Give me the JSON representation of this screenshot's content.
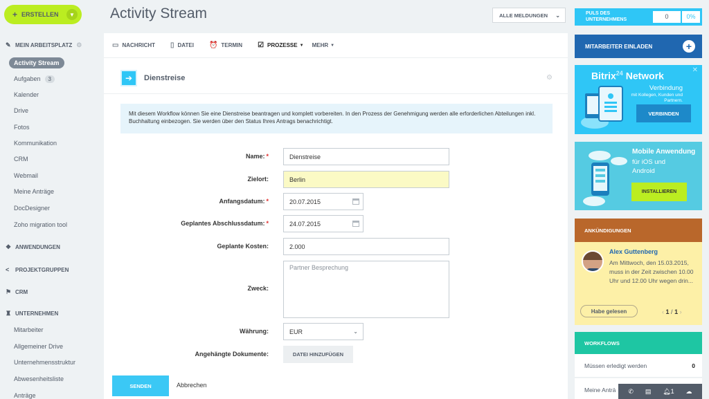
{
  "sidebar": {
    "create_label": "ERSTELLEN",
    "workplace_label": "MEIN ARBEITSPLATZ",
    "items": [
      {
        "label": "Activity Stream"
      },
      {
        "label": "Aufgaben",
        "badge": "3"
      },
      {
        "label": "Kalender"
      },
      {
        "label": "Drive"
      },
      {
        "label": "Fotos"
      },
      {
        "label": "Kommunikation"
      },
      {
        "label": "CRM"
      },
      {
        "label": "Webmail"
      },
      {
        "label": "Meine Anträge"
      },
      {
        "label": "DocDesigner"
      },
      {
        "label": "Zoho migration tool"
      }
    ],
    "sections": {
      "apps": "ANWENDUNGEN",
      "groups": "PROJEKTGRUPPEN",
      "crm": "CRM",
      "company": "UNTERNEHMEN"
    },
    "company_items": [
      {
        "label": "Mitarbeiter"
      },
      {
        "label": "Allgemeiner Drive"
      },
      {
        "label": "Unternehmensstruktur"
      },
      {
        "label": "Abwesenheitsliste"
      },
      {
        "label": "Anträge"
      }
    ]
  },
  "page": {
    "title": "Activity Stream",
    "filter_label": "ALLE MELDUNGEN"
  },
  "tabs": [
    {
      "label": "NACHRICHT",
      "icon": "message-icon"
    },
    {
      "label": "DATEI",
      "icon": "file-icon"
    },
    {
      "label": "TERMIN",
      "icon": "alarm-icon"
    },
    {
      "label": "PROZESSE",
      "icon": "process-icon"
    },
    {
      "label": "MEHR",
      "icon": ""
    }
  ],
  "form": {
    "title": "Dienstreise",
    "info": "Mit diesem Workflow können Sie eine Dienstreise beantragen und komplett vorbereiten. In den Prozess der Genehmigung werden alle erforderlichen Abteilungen inkl. Buchhaltung einbezogen. Sie werden über den Status Ihres Antrags benachrichtigt.",
    "fields": {
      "name_label": "Name:",
      "name_value": "Dienstreise",
      "ziel_label": "Zielort:",
      "ziel_value": "Berlin",
      "start_label": "Anfangsdatum:",
      "start_value": "20.07.2015",
      "end_label": "Geplantes Abschlussdatum:",
      "end_value": "24.07.2015",
      "cost_label": "Geplante Kosten:",
      "cost_value": "2.000",
      "purpose_label": "Zweck:",
      "purpose_value": "Partner Besprechung",
      "currency_label": "Währung:",
      "currency_value": "EUR",
      "docs_label": "Angehängte Dokumente:",
      "upload_label": "DATEI HINZUFÜGEN"
    },
    "required_mark": "*",
    "send_label": "SENDEN",
    "cancel_label": "Abbrechen"
  },
  "right": {
    "puls_label": "PULS DES UNTERNEHMENS",
    "puls_value": "0",
    "puls_percent": "0%",
    "invite_label": "MITARBEITER EINLADEN",
    "network": {
      "brand_a": "Bitrix",
      "brand_b": "24",
      "brand_c": "Network",
      "sub1": "Verbindung",
      "sub2": "mit Kollegen, Kunden und Partnern.",
      "button": "VERBINDEN"
    },
    "mobile": {
      "title": "Mobile Anwendung",
      "line1": "für iOS und",
      "line2": "Android",
      "button": "INSTALLIEREN"
    },
    "announcements": {
      "header": "ANKÜNDIGUNGEN",
      "author": "Alex Guttenberg",
      "text": "Am Mittwoch, den 15.03.2015, muss in der Zeit zwischen 10.00 Uhr und 12.00 Uhr wegen drin...",
      "read_label": "Habe gelesen",
      "pager_current": "1",
      "pager_sep": "/",
      "pager_total": "1"
    },
    "workflows": {
      "header": "WORKFLOWS",
      "rows": [
        {
          "label": "Müssen erledigt werden",
          "count": "0"
        },
        {
          "label": "Meine Anträ",
          "count": ""
        }
      ]
    }
  },
  "bottom_bar": {
    "notifications": "1"
  }
}
